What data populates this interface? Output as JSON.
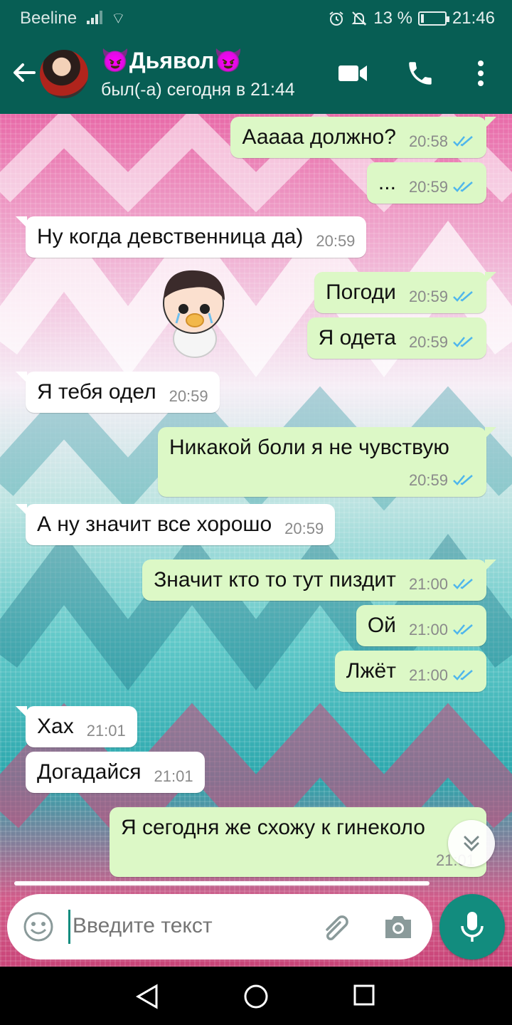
{
  "status_bar": {
    "carrier": "Beeline",
    "wifi": "⌔",
    "battery_percent": "13 %",
    "battery_level": 0.13,
    "time": "21:46"
  },
  "header": {
    "contact_name": "😈Дьявол😈",
    "status": "был(-а) сегодня в 21:44"
  },
  "messages": [
    {
      "dir": "out",
      "text": "Ааааа должно?",
      "time": "20:58",
      "read": true
    },
    {
      "dir": "out",
      "text": "...",
      "time": "20:59",
      "read": true
    },
    {
      "dir": "in",
      "text": "Ну когда девственница да)",
      "time": "20:59"
    },
    {
      "dir": "out",
      "text": "Погоди",
      "time": "20:59",
      "read": true
    },
    {
      "dir": "out",
      "text": "Я одета",
      "time": "20:59",
      "read": true
    },
    {
      "dir": "in",
      "text": "Я тебя одел",
      "time": "20:59"
    },
    {
      "dir": "out",
      "text": "Никакой боли я не чувствую",
      "time": "20:59",
      "read": true
    },
    {
      "dir": "in",
      "text": "А ну значит все хорошо",
      "time": "20:59"
    },
    {
      "dir": "out",
      "text": "Значит кто то тут пиздит",
      "time": "21:00",
      "read": true
    },
    {
      "dir": "out",
      "text": "Ой",
      "time": "21:00",
      "read": true
    },
    {
      "dir": "out",
      "text": "Лжёт",
      "time": "21:00",
      "read": true
    },
    {
      "dir": "in",
      "text": "Хах",
      "time": "21:01"
    },
    {
      "dir": "in",
      "text": "Догадайся",
      "time": "21:01"
    },
    {
      "dir": "out",
      "text": "Я сегодня же схожу к гинеколо",
      "time": "21:01",
      "read": false
    }
  ],
  "input": {
    "placeholder": "Введите текст"
  },
  "colors": {
    "header": "#075e54",
    "outgoing_bubble": "#dcf8c6",
    "incoming_bubble": "#ffffff",
    "accent": "#128c7e",
    "read_ticks": "#4fb6ec"
  },
  "icons": [
    "back-arrow-icon",
    "video-call-icon",
    "phone-icon",
    "more-vert-icon",
    "emoji-icon",
    "attach-icon",
    "camera-icon",
    "mic-icon",
    "scroll-down-icon",
    "nav-back-icon",
    "nav-home-icon",
    "nav-recent-icon"
  ]
}
